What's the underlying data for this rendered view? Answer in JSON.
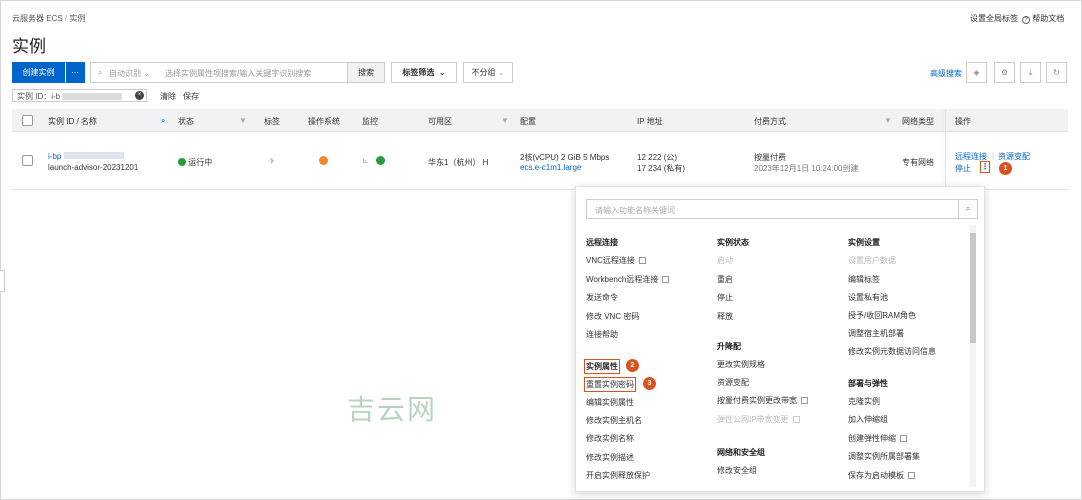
{
  "breadcrumb": {
    "root": "云服务器 ECS",
    "sep": "/",
    "current": "实例"
  },
  "header_links": {
    "global_tags": "设置全局标签",
    "help": "帮助文档",
    "help_icon": "?"
  },
  "page_title": "实例",
  "toolbar": {
    "create": "创建实例",
    "more": "···",
    "search_mode": "自动识别",
    "search_placeholder": "选择实例属性项搜索/输入关键字识别搜索",
    "search_btn": "搜索",
    "tag_filter": "标签筛选",
    "group": "不分组",
    "advanced": "高级搜索"
  },
  "filter": {
    "chip": "实例 ID：i-b",
    "clear": "清除",
    "save": "保存"
  },
  "table": {
    "headers": [
      "实例 ID / 名称",
      "状态",
      "标签",
      "操作系统",
      "监控",
      "可用区",
      "配置",
      "IP 地址",
      "付费方式",
      "网络类型",
      "操作"
    ],
    "row": {
      "id": "i-bp",
      "name": "launch-advisor-20231201",
      "status": "运行中",
      "zone": "华东1（杭州） H",
      "config1": "2核(vCPU)  2 GiB 5 Mbps",
      "config2": "ecs.e-c1m1.large",
      "ip_public": "12        222 (公)",
      "ip_private": "17        234 (私有)",
      "billing": "按量付费",
      "created": "2023年12月1日 10:24:00创建",
      "network": "专有网络",
      "actions": [
        "远程连接",
        "资源变配",
        "停止"
      ]
    }
  },
  "popup": {
    "search_placeholder": "请输入功能名称关键词",
    "col1": {
      "header": "远程连接",
      "items": [
        "VNC远程连接",
        "Workbench远程连接",
        "发送命令",
        "修改 VNC 密码",
        "连接帮助",
        "实例属性",
        "重置实例密码",
        "编辑实例属性",
        "修改实例主机名",
        "修改实例名称",
        "修改实例描述",
        "开启实例释放保护"
      ]
    },
    "col2": {
      "header": "实例状态",
      "items": [
        "启动",
        "重启",
        "停止",
        "释放"
      ],
      "header2": "升降配",
      "items2": [
        "更改实例规格",
        "资源变配",
        "按量付费实例更改带宽",
        "弹性公网IP带宽变更"
      ],
      "header3": "网络和安全组",
      "items3": [
        "修改安全组"
      ]
    },
    "col3": {
      "header": "实例设置",
      "items": [
        "设置用户数据",
        "编辑标签",
        "设置私有池",
        "授予/收回RAM角色",
        "调整宿主机部署",
        "修改实例元数据访问信息"
      ],
      "header2": "部署与弹性",
      "items2": [
        "克隆实例",
        "加入伸缩组",
        "创建弹性伸缩",
        "调整实例所属部署集",
        "保存为启动模板"
      ]
    }
  },
  "badges": [
    "1",
    "2",
    "3"
  ],
  "watermark": "吉云网"
}
